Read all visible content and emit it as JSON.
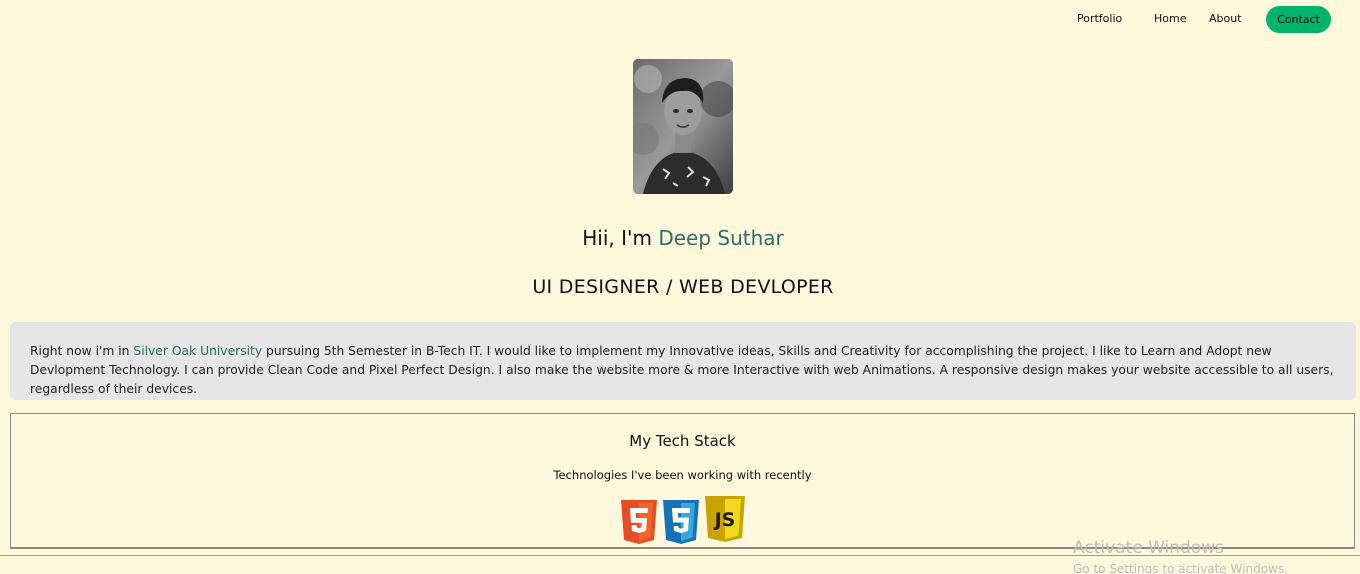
{
  "nav": {
    "portfolio": "Portfolio",
    "home": "Home",
    "about": "About",
    "contact": "Contact"
  },
  "hero": {
    "greeting_prefix": "Hii, I'm ",
    "name": "Deep Suthar",
    "role": "UI DESIGNER / WEB DEVLOPER"
  },
  "about": {
    "text_before": "Right now i'm in ",
    "university": "Silver Oak University",
    "text_after": " pursuing 5th Semester in B-Tech IT. I would like to implement my Innovative ideas, Skills and Creativity for accomplishing the project. I like to Learn and Adopt new Devlopment Technology. I can provide Clean Code and Pixel Perfect Design. I also make the website more & more Interactive with web Animations. A responsive design makes your website accessible to all users, regardless of their devices."
  },
  "tech": {
    "title": "My Tech Stack",
    "subtitle": "Technologies I've been working with recently",
    "icons": [
      "html5-icon",
      "css3-icon",
      "javascript-icon"
    ]
  },
  "watermark": {
    "line1": "Activate Windows",
    "line2": "Go to Settings to activate Windows."
  },
  "colors": {
    "background": "#fff8dc",
    "accent": "#2f6b6b",
    "contact_button": "#00b36b",
    "about_box": "#e6e6e6"
  }
}
